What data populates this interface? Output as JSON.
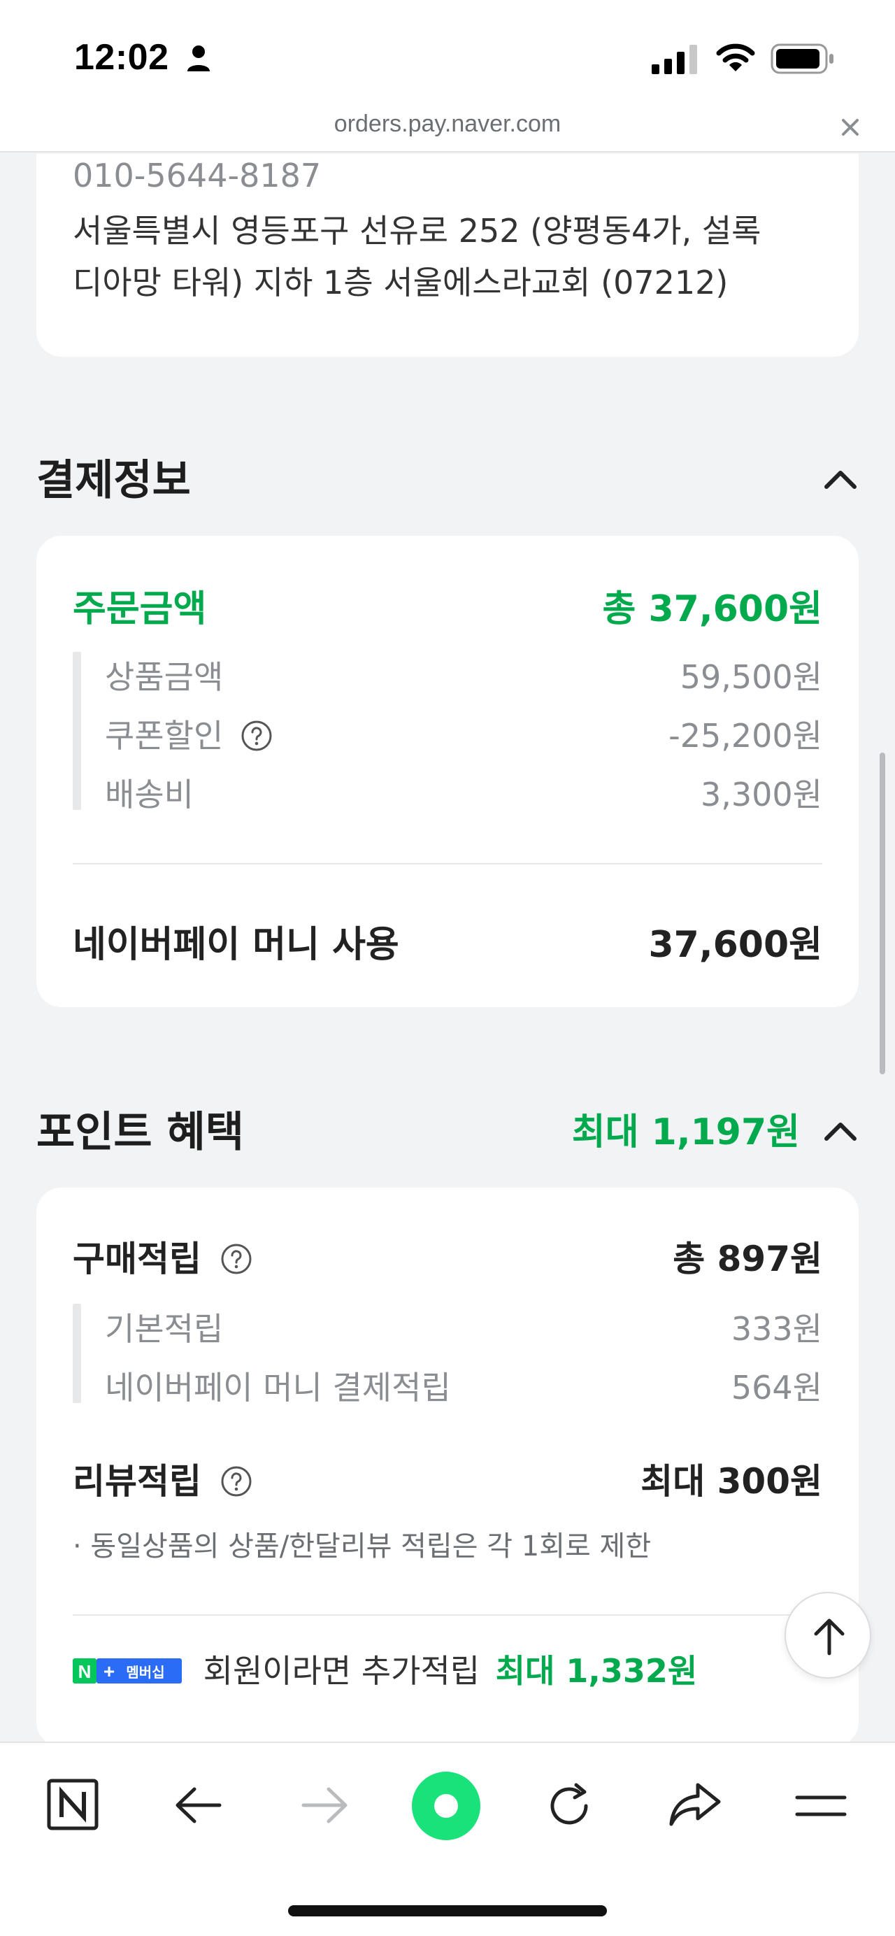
{
  "status_bar": {
    "time": "12:02"
  },
  "browser": {
    "url": "orders.pay.naver.com"
  },
  "address": {
    "phone": "010-5644-8187",
    "line1": "서울특별시 영등포구 선유로 252 (양평동4가, 설록",
    "line2": "디아망 타워) 지하 1층 서울에스라교회 (07212)"
  },
  "payment": {
    "title": "결제정보",
    "order_label": "주문금액",
    "order_total": "총 37,600원",
    "items": [
      {
        "label": "상품금액",
        "value": "59,500원"
      },
      {
        "label": "쿠폰할인",
        "value": "-25,200원"
      },
      {
        "label": "배송비",
        "value": "3,300원"
      }
    ],
    "method_label": "네이버페이 머니 사용",
    "method_value": "37,600원"
  },
  "points": {
    "title": "포인트 혜택",
    "max": "최대 1,197원",
    "purchase_label": "구매적립",
    "purchase_total": "총 897원",
    "purchase_items": [
      {
        "label": "기본적립",
        "value": "333원"
      },
      {
        "label": "네이버페이 머니 결제적립",
        "value": "564원"
      }
    ],
    "review_label": "리뷰적립",
    "review_value": "최대 300원",
    "review_note": "· 동일상품의 상품/한달리뷰 적립은 각 1회로 제한",
    "member_badge_n": "N",
    "member_badge_plus": "+",
    "member_badge_text": "멤버십",
    "member_text": "회원이라면 추가적립",
    "member_value": "최대 1,332원"
  },
  "colors": {
    "accent_green": "#03a94d",
    "badge_blue": "#2b6cf6",
    "nav_green": "#19e27a"
  }
}
